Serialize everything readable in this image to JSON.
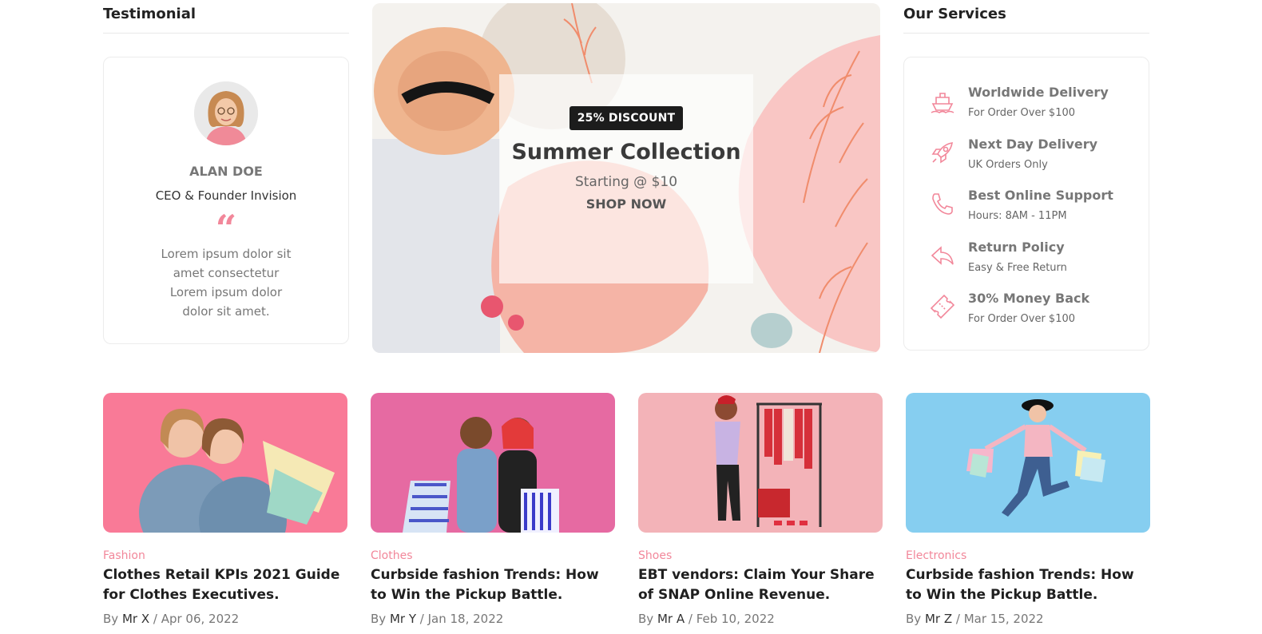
{
  "testimonial": {
    "heading": "Testimonial",
    "name": "ALAN DOE",
    "role": "CEO & Founder Invision",
    "quote_mark": "“",
    "text": "Lorem ipsum dolor sit amet consectetur Lorem ipsum dolor dolor sit amet."
  },
  "banner": {
    "badge": "25% DISCOUNT",
    "title": "Summer Collection",
    "subtitle": "Starting @ $10",
    "cta": "SHOP NOW"
  },
  "services": {
    "heading": "Our Services",
    "items": [
      {
        "title": "Worldwide Delivery",
        "subtitle": "For Order Over $100",
        "icon": "ship-icon"
      },
      {
        "title": "Next Day Delivery",
        "subtitle": "UK Orders Only",
        "icon": "rocket-icon"
      },
      {
        "title": "Best Online Support",
        "subtitle": "Hours: 8AM - 11PM",
        "icon": "phone-icon"
      },
      {
        "title": "Return Policy",
        "subtitle": "Easy & Free Return",
        "icon": "return-arrow-icon"
      },
      {
        "title": "30% Money Back",
        "subtitle": "For Order Over $100",
        "icon": "ticket-icon"
      }
    ]
  },
  "blog": {
    "by_label": "By",
    "posts": [
      {
        "category": "Fashion",
        "title": "Clothes Retail KPIs 2021 Guide for Clothes Executives.",
        "author": "Mr X",
        "date": "Apr 06, 2022"
      },
      {
        "category": "Clothes",
        "title": "Curbside fashion Trends: How to Win the Pickup Battle.",
        "author": "Mr Y",
        "date": "Jan 18, 2022"
      },
      {
        "category": "Shoes",
        "title": "EBT vendors: Claim Your Share of SNAP Online Revenue.",
        "author": "Mr A",
        "date": "Feb 10, 2022"
      },
      {
        "category": "Electronics",
        "title": "Curbside fashion Trends: How to Win the Pickup Battle.",
        "author": "Mr Z",
        "date": "Mar 15, 2022"
      }
    ]
  },
  "colors": {
    "accent": "#f2879a",
    "dark": "#1c1c1c"
  }
}
